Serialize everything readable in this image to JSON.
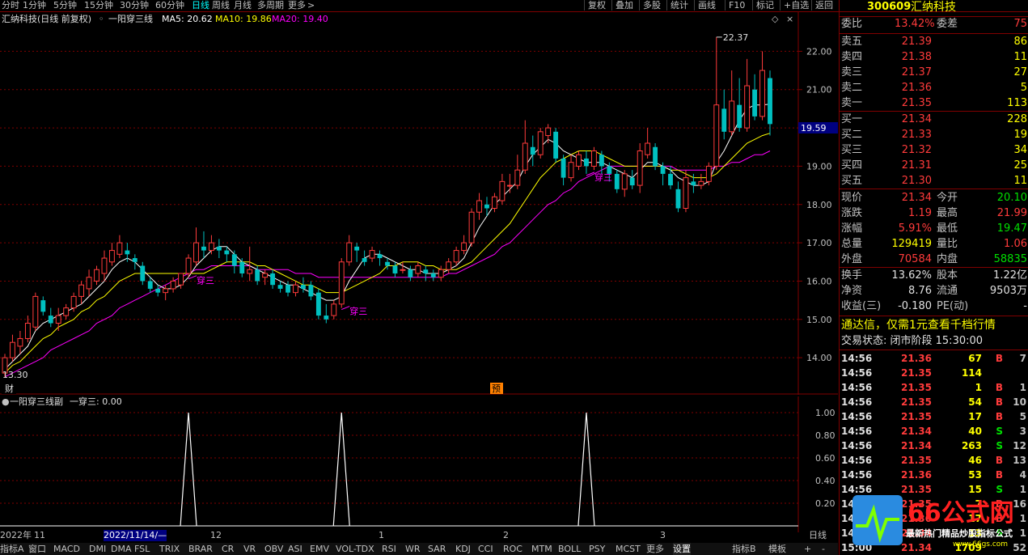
{
  "topbar": {
    "periods": [
      "分时",
      "1分钟",
      "5分钟",
      "15分钟",
      "30分钟",
      "60分钟",
      "日线",
      "周线",
      "月线",
      "多周期",
      "更多"
    ],
    "active_period": "日线",
    "right_buttons": [
      "复权",
      "叠加",
      "多股",
      "统计",
      "画线",
      "F10",
      "标记",
      "+自选",
      "返回"
    ]
  },
  "main_chart": {
    "header_title": "汇纳科技(日线 前复权)",
    "indicator_name": "一阳穿三线",
    "ma5_label": "MA5: 20.62",
    "ma10_label": "MA10: 19.86",
    "ma20_label": "MA20: 19.40",
    "price_labels": [
      "22.00",
      "21.00",
      "20.00",
      "19.00",
      "18.00",
      "17.00",
      "16.00",
      "15.00",
      "14.00"
    ],
    "current_price_tag": "19.59",
    "high_label": "22.37",
    "low_label": "13.30",
    "signal_label": "穿三",
    "finance_marker": "财",
    "forecast_marker": "预"
  },
  "chart_data": {
    "type": "candlestick",
    "title": "汇纳科技(日线 前复权)",
    "ylim": [
      13.2,
      22.6
    ],
    "candles": [
      [
        13.6,
        14.0,
        13.5,
        14.1
      ],
      [
        14.0,
        14.4,
        13.9,
        14.6
      ],
      [
        14.3,
        14.5,
        14.1,
        14.7
      ],
      [
        14.5,
        14.9,
        14.4,
        15.1
      ],
      [
        14.8,
        15.6,
        14.7,
        15.7
      ],
      [
        15.5,
        15.2,
        15.1,
        15.6
      ],
      [
        15.1,
        14.9,
        14.8,
        15.3
      ],
      [
        14.9,
        15.1,
        14.7,
        15.3
      ],
      [
        15.1,
        15.3,
        15.0,
        15.4
      ],
      [
        15.3,
        15.6,
        15.2,
        15.7
      ],
      [
        15.6,
        15.9,
        15.4,
        16.0
      ],
      [
        15.8,
        16.1,
        15.6,
        16.3
      ],
      [
        16.0,
        16.3,
        15.9,
        16.4
      ],
      [
        16.2,
        16.6,
        16.0,
        16.8
      ],
      [
        16.5,
        16.8,
        16.4,
        17.0
      ],
      [
        16.7,
        17.0,
        16.6,
        17.2
      ],
      [
        16.8,
        16.7,
        16.5,
        17.0
      ],
      [
        16.6,
        16.5,
        16.3,
        16.7
      ],
      [
        16.4,
        16.0,
        15.9,
        16.5
      ],
      [
        16.0,
        15.8,
        15.7,
        16.1
      ],
      [
        15.8,
        15.7,
        15.6,
        15.9
      ],
      [
        15.7,
        15.8,
        15.5,
        15.9
      ],
      [
        15.8,
        16.0,
        15.7,
        16.1
      ],
      [
        15.9,
        16.2,
        15.8,
        16.2
      ],
      [
        16.2,
        16.6,
        16.1,
        16.7
      ],
      [
        16.5,
        17.0,
        16.4,
        17.4
      ],
      [
        16.9,
        16.8,
        16.6,
        17.3
      ],
      [
        16.8,
        17.0,
        16.7,
        17.2
      ],
      [
        16.9,
        16.8,
        16.6,
        17.1
      ],
      [
        16.8,
        16.7,
        16.5,
        16.9
      ],
      [
        16.7,
        16.4,
        16.2,
        16.8
      ],
      [
        16.5,
        16.2,
        16.1,
        16.6
      ],
      [
        16.2,
        16.3,
        16.0,
        16.9
      ],
      [
        16.3,
        16.0,
        15.9,
        16.4
      ],
      [
        16.1,
        16.2,
        15.9,
        16.3
      ],
      [
        16.2,
        15.9,
        15.8,
        16.3
      ],
      [
        15.9,
        15.8,
        15.7,
        16.0
      ],
      [
        15.9,
        15.7,
        15.6,
        16.0
      ],
      [
        15.7,
        15.9,
        15.6,
        16.0
      ],
      [
        15.9,
        15.8,
        15.7,
        16.1
      ],
      [
        15.9,
        15.6,
        15.5,
        16.0
      ],
      [
        15.7,
        15.1,
        15.0,
        15.8
      ],
      [
        15.1,
        15.0,
        14.9,
        15.4
      ],
      [
        15.1,
        15.4,
        15.0,
        15.5
      ],
      [
        15.4,
        16.5,
        15.3,
        16.6
      ],
      [
        16.5,
        17.0,
        16.4,
        17.2
      ],
      [
        16.9,
        16.8,
        16.5,
        17.0
      ],
      [
        16.6,
        16.5,
        16.4,
        16.8
      ],
      [
        16.6,
        16.8,
        16.5,
        16.9
      ],
      [
        16.7,
        16.6,
        16.4,
        16.8
      ],
      [
        16.5,
        16.4,
        16.3,
        16.6
      ],
      [
        16.4,
        16.2,
        16.1,
        16.5
      ],
      [
        16.3,
        16.3,
        16.2,
        16.5
      ],
      [
        16.3,
        16.1,
        16.0,
        16.4
      ],
      [
        16.2,
        16.4,
        16.1,
        16.5
      ],
      [
        16.3,
        16.2,
        16.0,
        16.4
      ],
      [
        16.2,
        16.1,
        16.0,
        16.3
      ],
      [
        16.1,
        16.3,
        16.0,
        16.4
      ],
      [
        16.3,
        16.5,
        16.2,
        16.6
      ],
      [
        16.5,
        16.8,
        16.4,
        16.9
      ],
      [
        16.8,
        17.0,
        16.7,
        17.2
      ],
      [
        17.0,
        17.8,
        16.9,
        17.9
      ],
      [
        17.8,
        18.1,
        17.6,
        18.3
      ],
      [
        18.0,
        17.9,
        17.7,
        18.2
      ],
      [
        17.9,
        18.2,
        17.8,
        18.3
      ],
      [
        18.1,
        18.6,
        18.0,
        18.8
      ],
      [
        18.5,
        18.5,
        18.3,
        18.8
      ],
      [
        18.5,
        18.9,
        18.4,
        19.3
      ],
      [
        18.9,
        19.6,
        18.8,
        20.2
      ],
      [
        19.5,
        19.3,
        19.0,
        19.8
      ],
      [
        19.3,
        19.9,
        19.2,
        20.0
      ],
      [
        19.8,
        20.0,
        19.6,
        20.1
      ],
      [
        19.9,
        19.2,
        19.1,
        20.0
      ],
      [
        19.2,
        18.7,
        18.5,
        19.3
      ],
      [
        18.7,
        19.1,
        18.6,
        19.3
      ],
      [
        19.0,
        19.3,
        18.9,
        19.4
      ],
      [
        19.2,
        19.0,
        18.8,
        19.4
      ],
      [
        19.0,
        19.4,
        18.9,
        19.5
      ],
      [
        19.3,
        19.0,
        18.8,
        19.4
      ],
      [
        19.0,
        18.8,
        18.6,
        19.1
      ],
      [
        18.8,
        18.4,
        18.3,
        18.9
      ],
      [
        18.4,
        18.8,
        18.2,
        18.9
      ],
      [
        18.7,
        18.5,
        18.4,
        18.9
      ],
      [
        18.5,
        19.4,
        18.3,
        19.6
      ],
      [
        19.3,
        19.6,
        19.2,
        20.0
      ],
      [
        19.5,
        19.0,
        18.9,
        19.6
      ],
      [
        19.0,
        18.8,
        18.5,
        19.1
      ],
      [
        18.8,
        18.5,
        18.4,
        19.0
      ],
      [
        18.4,
        17.9,
        17.8,
        18.6
      ],
      [
        17.9,
        18.7,
        17.8,
        18.9
      ],
      [
        18.6,
        18.5,
        18.3,
        18.8
      ],
      [
        18.5,
        18.6,
        18.4,
        18.8
      ],
      [
        18.6,
        19.0,
        18.5,
        19.1
      ],
      [
        19.0,
        20.6,
        18.9,
        22.37
      ],
      [
        20.5,
        19.9,
        19.7,
        21.0
      ],
      [
        19.9,
        20.7,
        19.8,
        21.5
      ],
      [
        20.6,
        20.0,
        19.9,
        21.3
      ],
      [
        20.0,
        21.1,
        19.9,
        21.8
      ],
      [
        21.0,
        20.3,
        20.2,
        21.4
      ],
      [
        20.3,
        21.5,
        20.2,
        22.0
      ],
      [
        21.3,
        20.1,
        19.8,
        21.5
      ]
    ],
    "ma5": [
      13.7,
      13.9,
      14.1,
      14.3,
      14.7,
      14.9,
      15.0,
      15.1,
      15.2,
      15.3,
      15.4,
      15.6,
      15.8,
      16.0,
      16.3,
      16.5,
      16.6,
      16.5,
      16.3,
      16.1,
      15.9,
      15.8,
      15.8,
      15.9,
      16.1,
      16.4,
      16.6,
      16.8,
      16.9,
      16.9,
      16.7,
      16.5,
      16.4,
      16.3,
      16.2,
      16.1,
      16.0,
      15.9,
      15.9,
      15.8,
      15.7,
      15.6,
      15.5,
      15.5,
      15.6,
      16.0,
      16.3,
      16.6,
      16.7,
      16.7,
      16.6,
      16.5,
      16.4,
      16.3,
      16.3,
      16.2,
      16.2,
      16.2,
      16.3,
      16.4,
      16.6,
      17.0,
      17.4,
      17.7,
      18.0,
      18.2,
      18.4,
      18.6,
      19.0,
      19.3,
      19.5,
      19.7,
      19.6,
      19.4,
      19.3,
      19.2,
      19.1,
      19.1,
      19.1,
      19.0,
      18.9,
      18.8,
      18.7,
      18.9,
      19.1,
      19.1,
      19.0,
      18.9,
      18.7,
      18.6,
      18.5,
      18.5,
      18.6,
      19.1,
      19.4,
      19.8,
      20.2,
      20.5,
      20.6,
      20.6,
      20.62
    ],
    "ma10": [
      13.6,
      13.8,
      13.9,
      14.1,
      14.3,
      14.5,
      14.6,
      14.8,
      14.9,
      15.0,
      15.2,
      15.3,
      15.5,
      15.6,
      15.8,
      16.0,
      16.1,
      16.2,
      16.2,
      16.2,
      16.2,
      16.2,
      16.2,
      16.2,
      16.2,
      16.2,
      16.2,
      16.3,
      16.4,
      16.5,
      16.5,
      16.5,
      16.5,
      16.4,
      16.4,
      16.3,
      16.2,
      16.1,
      16.0,
      15.9,
      15.9,
      15.8,
      15.7,
      15.7,
      15.7,
      15.8,
      15.9,
      16.0,
      16.1,
      16.2,
      16.4,
      16.4,
      16.5,
      16.5,
      16.5,
      16.4,
      16.4,
      16.3,
      16.3,
      16.3,
      16.4,
      16.5,
      16.7,
      16.9,
      17.1,
      17.3,
      17.5,
      17.8,
      18.1,
      18.4,
      18.7,
      18.9,
      19.1,
      19.2,
      19.3,
      19.4,
      19.4,
      19.4,
      19.3,
      19.2,
      19.1,
      19.0,
      19.0,
      19.0,
      19.0,
      19.0,
      19.0,
      18.9,
      18.9,
      18.8,
      18.7,
      18.7,
      18.7,
      18.8,
      19.0,
      19.2,
      19.4,
      19.6,
      19.7,
      19.8,
      19.86
    ],
    "ma20": [
      13.5,
      13.6,
      13.7,
      13.8,
      13.9,
      14.0,
      14.2,
      14.3,
      14.4,
      14.5,
      14.6,
      14.7,
      14.9,
      15.0,
      15.1,
      15.3,
      15.4,
      15.5,
      15.6,
      15.7,
      15.8,
      15.9,
      16.0,
      16.1,
      16.2,
      16.3,
      16.3,
      16.4,
      16.4,
      16.4,
      16.4,
      16.4,
      16.4,
      16.3,
      16.3,
      16.3,
      16.3,
      16.3,
      16.2,
      16.2,
      16.2,
      16.1,
      16.1,
      16.1,
      16.1,
      16.1,
      16.1,
      16.1,
      16.1,
      16.1,
      16.1,
      16.1,
      16.1,
      16.1,
      16.1,
      16.1,
      16.1,
      16.1,
      16.2,
      16.2,
      16.3,
      16.4,
      16.5,
      16.6,
      16.7,
      16.9,
      17.0,
      17.2,
      17.4,
      17.6,
      17.8,
      18.0,
      18.1,
      18.3,
      18.4,
      18.6,
      18.7,
      18.8,
      18.9,
      19.0,
      19.0,
      19.0,
      19.0,
      19.0,
      19.0,
      19.0,
      19.0,
      19.0,
      18.9,
      18.9,
      18.9,
      18.9,
      18.9,
      19.0,
      19.0,
      19.1,
      19.1,
      19.2,
      19.3,
      19.3,
      19.4
    ],
    "signal_bars": [
      24,
      44,
      76
    ],
    "signal_values": [
      1,
      1,
      1
    ]
  },
  "sub_chart": {
    "title": "一阳穿三线副",
    "value_label": "一穿三: 0.00",
    "axis_labels": [
      "1.00",
      "0.80",
      "0.60",
      "0.40",
      "0.20"
    ]
  },
  "date_axis": {
    "labels": [
      "2022年",
      "11",
      "2022/11/14/—",
      "12",
      "1",
      "2",
      "3"
    ],
    "period": "日线"
  },
  "bottom_tabs": [
    "指标A",
    "窗口",
    "MACD",
    "DMI",
    "DMA",
    "FSL",
    "TRIX",
    "BRAR",
    "CR",
    "VR",
    "OBV",
    "ASI",
    "EMV",
    "VOL-TDX",
    "RSI",
    "WR",
    "SAR",
    "KDJ",
    "CCI",
    "ROC",
    "MTM",
    "BOLL",
    "PSY",
    "MCST",
    "更多",
    "设置",
    "指标B",
    "模板"
  ],
  "active_tab": "设置",
  "quote": {
    "code": "300609",
    "name": "汇纳科技",
    "wb_label": "委比",
    "wb": "13.42%",
    "wc_label": "委差",
    "wc": "75",
    "asks": [
      [
        "卖五",
        "21.39",
        "86"
      ],
      [
        "卖四",
        "21.38",
        "11"
      ],
      [
        "卖三",
        "21.37",
        "27"
      ],
      [
        "卖二",
        "21.36",
        "5"
      ],
      [
        "卖一",
        "21.35",
        "113"
      ]
    ],
    "bids": [
      [
        "买一",
        "21.34",
        "228"
      ],
      [
        "买二",
        "21.33",
        "19"
      ],
      [
        "买三",
        "21.32",
        "34"
      ],
      [
        "买四",
        "21.31",
        "25"
      ],
      [
        "买五",
        "21.30",
        "11"
      ]
    ],
    "stats": [
      [
        "现价",
        "21.34",
        "今开",
        "20.10"
      ],
      [
        "涨跌",
        "1.19",
        "最高",
        "21.99"
      ],
      [
        "涨幅",
        "5.91%",
        "最低",
        "19.47"
      ],
      [
        "总量",
        "129419",
        "量比",
        "1.06"
      ],
      [
        "外盘",
        "70584",
        "内盘",
        "58835"
      ]
    ],
    "stats2": [
      [
        "换手",
        "13.62%",
        "股本",
        "1.22亿"
      ],
      [
        "净资",
        "8.76",
        "流通",
        "9503万"
      ],
      [
        "收益(三)",
        "-0.180",
        "PE(动)",
        "-"
      ]
    ],
    "promo": "通达信，仅需1元查看千档行情",
    "trade_status": "交易状态: 闭市阶段 15:30:00",
    "ticks": [
      [
        "14:56",
        "21.36",
        "67",
        "B",
        "7"
      ],
      [
        "14:56",
        "21.35",
        "114",
        "",
        ""
      ],
      [
        "14:56",
        "21.35",
        "1",
        "B",
        "1"
      ],
      [
        "14:56",
        "21.35",
        "54",
        "B",
        "10"
      ],
      [
        "14:56",
        "21.35",
        "17",
        "B",
        "5"
      ],
      [
        "14:56",
        "21.34",
        "40",
        "S",
        "3"
      ],
      [
        "14:56",
        "21.34",
        "263",
        "S",
        "12"
      ],
      [
        "14:56",
        "21.35",
        "46",
        "B",
        "13"
      ],
      [
        "14:56",
        "21.36",
        "53",
        "B",
        "4"
      ],
      [
        "14:56",
        "21.35",
        "15",
        "S",
        "1"
      ],
      [
        "14:56",
        "21.35",
        "7",
        "B",
        "16"
      ],
      [
        "14:56",
        "21.36",
        "17",
        "B",
        "1"
      ],
      [
        "14:57",
        "21.34",
        "13",
        "S",
        "1"
      ],
      [
        "15:00",
        "21.34",
        "1709",
        "",
        "52"
      ]
    ]
  },
  "watermark": {
    "brand": "66公式网",
    "tagline": "最新热门精品炒股指标公式",
    "url": "www.66gs.com"
  },
  "colors": {
    "up": "#ff3b3b",
    "down": "#00c0c0",
    "ma5": "#ffffff",
    "ma10": "#ffff00",
    "ma20": "#ff00ff",
    "grid": "#800000",
    "signal": "#ff00ff"
  }
}
